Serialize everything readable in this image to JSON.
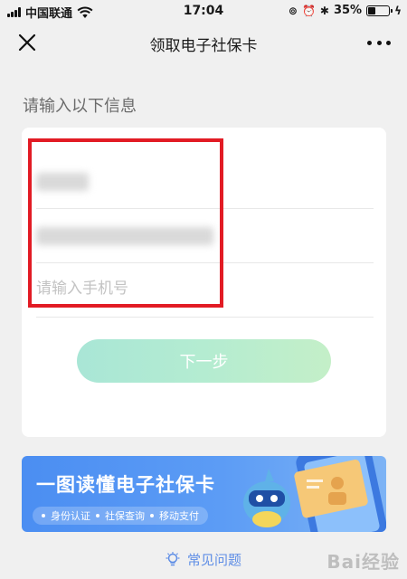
{
  "status_bar": {
    "carrier": "中国联通",
    "time": "17:04",
    "battery": "35%",
    "battery_level": 0.35
  },
  "nav": {
    "title": "领取电子社保卡"
  },
  "form": {
    "section_label": "请输入以下信息",
    "phone_placeholder": "请输入手机号",
    "next_button": "下一步"
  },
  "banner": {
    "title": "一图读懂电子社保卡",
    "tags": [
      "身份认证",
      "社保查询",
      "移动支付"
    ]
  },
  "faq": {
    "label": "常见问题"
  },
  "watermark": "Bai经验",
  "colors": {
    "highlight": "#e21b24",
    "accent": "#5f8ee6",
    "banner": "#4b8ef2"
  }
}
